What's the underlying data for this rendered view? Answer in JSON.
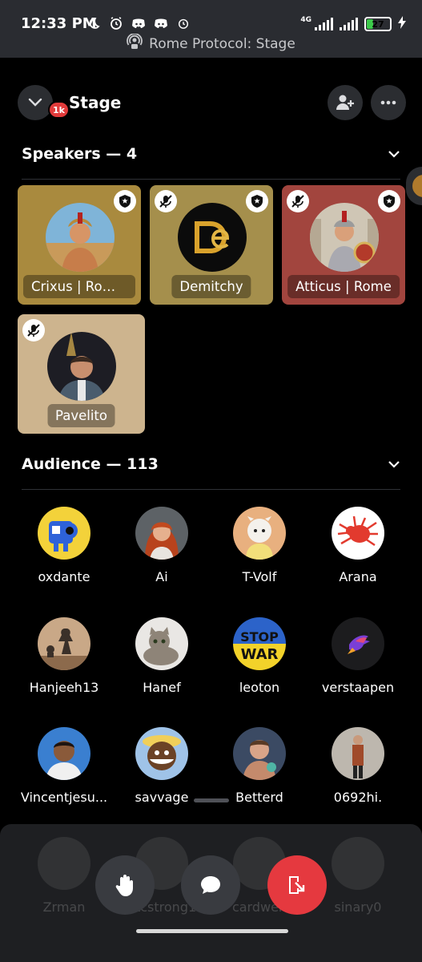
{
  "status_bar": {
    "time": "12:33 PM",
    "network": "4G",
    "battery": "27",
    "battery_level": 0.27,
    "subtitle": "Rome Protocol: Stage"
  },
  "header": {
    "title": "Stage",
    "badge": "1k"
  },
  "speakers": {
    "heading": "Speakers — 4",
    "items": [
      {
        "name": "Crixus | Rom...",
        "moderator": true,
        "muted": false
      },
      {
        "name": "Demitchy",
        "moderator": true,
        "muted": true
      },
      {
        "name": "Atticus | Rome",
        "moderator": true,
        "muted": true
      },
      {
        "name": "Pavelito",
        "moderator": false,
        "muted": true
      }
    ]
  },
  "audience": {
    "heading": "Audience — 113",
    "items": [
      {
        "name": "oxdante"
      },
      {
        "name": "Ai"
      },
      {
        "name": "T-Volf"
      },
      {
        "name": "Arana"
      },
      {
        "name": "Hanjeeh13"
      },
      {
        "name": "Hanef"
      },
      {
        "name": "leoton"
      },
      {
        "name": "verstaapen"
      },
      {
        "name": "Vincentjesu..."
      },
      {
        "name": "savvage"
      },
      {
        "name": "Betterd"
      },
      {
        "name": "0692hi."
      },
      {
        "name": "Zrman"
      },
      {
        "name": "btcstrong1"
      },
      {
        "name": "cardwen"
      },
      {
        "name": "sinary0"
      }
    ]
  },
  "icons": {
    "back": "chevron-down-icon",
    "invite": "add-user-icon",
    "more": "more-icon",
    "raise_hand": "hand-icon",
    "chat": "chat-icon",
    "leave": "leave-stage-icon"
  },
  "colors": {
    "tile_crixus": "#a98a3e",
    "tile_demitchy": "#a58f4c",
    "tile_atticus": "#a2453e",
    "tile_pavelito": "#cdb48e",
    "leave_button": "#e5393f",
    "action_button": "#393b40"
  }
}
